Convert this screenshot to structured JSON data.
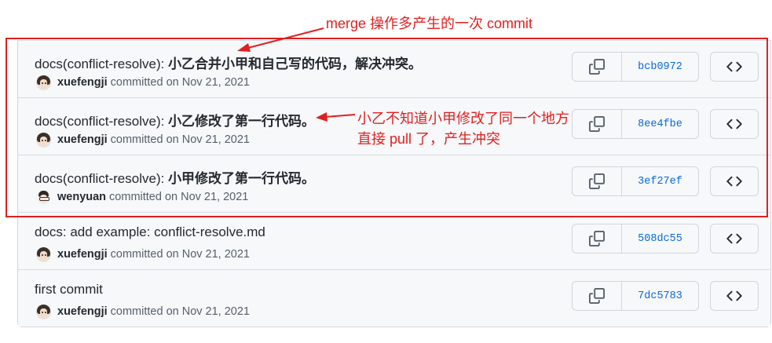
{
  "commits": [
    {
      "prefix": "docs(conflict-resolve): ",
      "message_zh": "小乙合并小甲和自己写的代码，解决冲突。",
      "author": "xuefengji",
      "date_text": "committed on Nov 21, 2021",
      "sha": "bcb0972"
    },
    {
      "prefix": "docs(conflict-resolve): ",
      "message_zh": "小乙修改了第一行代码。",
      "author": "xuefengji",
      "date_text": "committed on Nov 21, 2021",
      "sha": "8ee4fbe"
    },
    {
      "prefix": "docs(conflict-resolve): ",
      "message_zh": "小甲修改了第一行代码。",
      "author": "wenyuan",
      "date_text": "committed on Nov 21, 2021",
      "sha": "3ef27ef"
    },
    {
      "prefix": "docs: add example: conflict-resolve.md",
      "message_zh": "",
      "author": "xuefengji",
      "date_text": "committed on Nov 21, 2021",
      "sha": "508dc55"
    },
    {
      "prefix": "first commit",
      "message_zh": "",
      "author": "xuefengji",
      "date_text": "committed on Nov 21, 2021",
      "sha": "7dc5783"
    }
  ],
  "annotations": {
    "top": "merge 操作多产生的一次 commit",
    "right_line1": "小乙不知道小甲修改了同一个地方",
    "right_line2": "直接 pull 了，产生冲突"
  },
  "icons": {
    "copy": "copy-icon",
    "browse": "code-icon"
  },
  "colors": {
    "annotation": "#e02020",
    "sha_link": "#0969da"
  }
}
